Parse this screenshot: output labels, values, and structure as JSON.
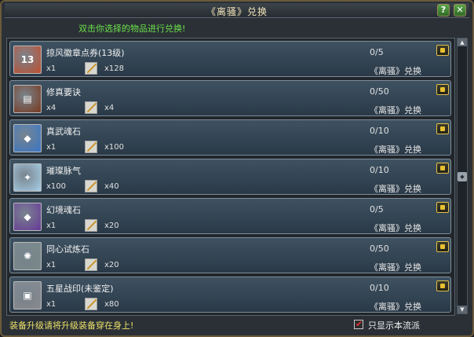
{
  "window": {
    "title": "《离骚》兑换",
    "help_label": "?",
    "close_label": "✕"
  },
  "subtitle": "双击你选择的物品进行兑换!",
  "items": [
    {
      "name": "掠风徽章点券(13级)",
      "qty": "x1",
      "cost": "x128",
      "progress": "0/5",
      "action": "《离骚》兑换",
      "icon_color": "#c05030",
      "icon_glyph": "13"
    },
    {
      "name": "修真要诀",
      "qty": "x4",
      "cost": "x4",
      "progress": "0/50",
      "action": "《离骚》兑换",
      "icon_color": "#7a3a20",
      "icon_glyph": "▤"
    },
    {
      "name": "真武魂石",
      "qty": "x1",
      "cost": "x100",
      "progress": "0/10",
      "action": "《离骚》兑换",
      "icon_color": "#3a78c8",
      "icon_glyph": "◆"
    },
    {
      "name": "璀璨脉气",
      "qty": "x100",
      "cost": "x40",
      "progress": "0/10",
      "action": "《离骚》兑换",
      "icon_color": "#a8d0e8",
      "icon_glyph": "✦"
    },
    {
      "name": "幻境魂石",
      "qty": "x1",
      "cost": "x20",
      "progress": "0/5",
      "action": "《离骚》兑换",
      "icon_color": "#6a3a9a",
      "icon_glyph": "◆"
    },
    {
      "name": "同心试炼石",
      "qty": "x1",
      "cost": "x20",
      "progress": "0/50",
      "action": "《离骚》兑换",
      "icon_color": "#7a8a8a",
      "icon_glyph": "✺"
    },
    {
      "name": "五星战印(未鉴定)",
      "qty": "x1",
      "cost": "x80",
      "progress": "0/10",
      "action": "《离骚》兑换",
      "icon_color": "#8a8a90",
      "icon_glyph": "▣"
    }
  ],
  "footer": {
    "hint": "装备升级请将升级装备穿在身上!",
    "checkbox_label": "只显示本流派",
    "checkbox_checked": true
  },
  "scrollbar": {
    "up_label": "▲",
    "down_label": "▼",
    "thumb_label": "◆"
  }
}
